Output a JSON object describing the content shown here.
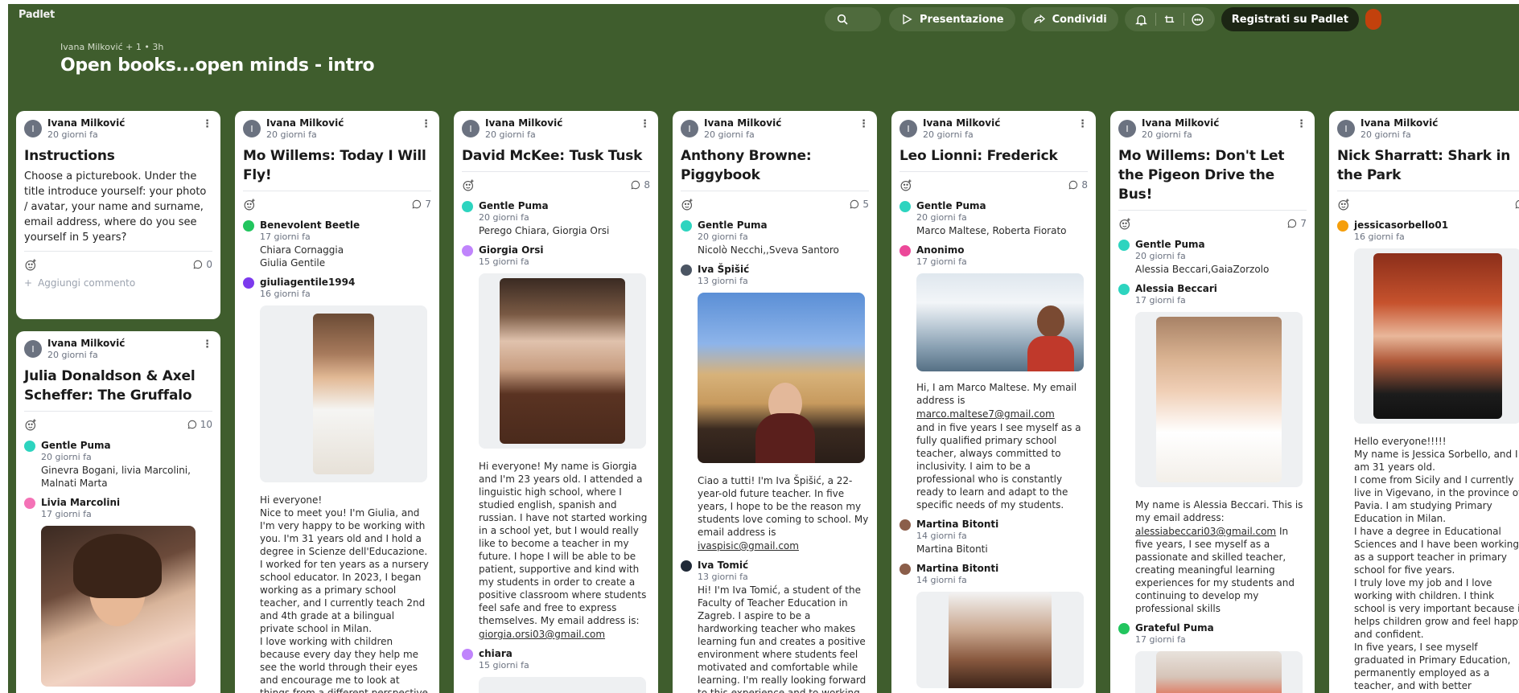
{
  "app": {
    "logo": "Padlet"
  },
  "topbar": {
    "presentation_label": "Presentazione",
    "share_label": "Condividi",
    "signup_label": "Registrati su Padlet"
  },
  "board": {
    "meta": "Ivana Milković + 1 • 3h",
    "title": "Open books...open minds - intro"
  },
  "cards": {
    "instructions": {
      "author": "Ivana Milković",
      "initial": "I",
      "time": "20 giorni fa",
      "title": "Instructions",
      "body": "Choose a picturebook. Under the title introduce yourself: your photo / avatar, your name and surname, email address, where do you see yourself in 5 years?",
      "comments_count": "0",
      "add_comment": "Aggiungi commento"
    },
    "gruffalo": {
      "author": "Ivana Milković",
      "initial": "I",
      "time": "20 giorni fa",
      "title": "Julia Donaldson & Axel Scheffer: The Gruffalo",
      "comments_count": "10",
      "c1": {
        "name": "Gentle Puma",
        "time": "20 giorni fa",
        "text": "Ginevra Bogani, livia Marcolini, Malnati Marta"
      },
      "c2": {
        "name": "Livia Marcolini",
        "time": "17 giorni fa"
      }
    },
    "willems": {
      "author": "Ivana Milković",
      "initial": "I",
      "time": "20 giorni fa",
      "title": "Mo Willems: Today I Will Fly!",
      "comments_count": "7",
      "c1": {
        "name": "Benevolent Beetle",
        "time": "17 giorni fa",
        "text": "Chiara Cornaggia\nGiulia Gentile"
      },
      "c2": {
        "name": "giuliagentile1994",
        "time": "16 giorni fa",
        "text": "Hi everyone!\nNice to meet you! I'm Giulia, and I'm very happy to be working with you. I'm 31 years old and I hold a degree in Scienze dell'Educazione. I worked for ten years as a nursery school educator. In 2023, I began working as a primary school teacher, and I currently teach 2nd and 4th grade at a bilingual private school in Milan.\nI love working with children because every day they help me see the world through their eyes and encourage me to look at things from a different perspective.\nMy email address is"
      }
    },
    "tusk": {
      "author": "Ivana Milković",
      "initial": "I",
      "time": "20 giorni fa",
      "title": "David McKee: Tusk Tusk",
      "comments_count": "8",
      "c1": {
        "name": "Gentle Puma",
        "time": "20 giorni fa",
        "text": "Perego Chiara, Giorgia Orsi"
      },
      "c2": {
        "name": "Giorgia Orsi",
        "time": "15 giorni fa",
        "text": "Hi everyone! My name is Giorgia and I'm 23 years old. I attended a linguistic high school, where I studied english, spanish and russian. I have not started working in a school yet, but I would really like to become a teacher in my future. I hope I will be able to be patient, supportive and kind with my students in order to create a positive classroom where students feel safe and free to express themselves. My email address is:",
        "email": "giorgia.orsi03@gmail.com"
      },
      "c3": {
        "name": "chiara",
        "time": "15 giorni fa"
      }
    },
    "piggybook": {
      "author": "Ivana Milković",
      "initial": "I",
      "time": "20 giorni fa",
      "title": "Anthony Browne: Piggybook",
      "comments_count": "5",
      "c1": {
        "name": "Gentle Puma",
        "time": "20 giorni fa",
        "text": "Nicolò Necchi,,Sveva Santoro"
      },
      "c2": {
        "name": "Iva Špišić",
        "time": "13 giorni fa",
        "text": "Ciao a tutti! I'm Iva Špišić, a 22-year-old future teacher. In five years, I hope to be the reason my students love coming to school. My email address is",
        "email": "ivaspisic@gmail.com"
      },
      "c3": {
        "name": "Iva Tomić",
        "time": "13 giorni fa",
        "text": "Hi! I'm Iva Tomić, a student of the Faculty of Teacher Education in Zagreb. I aspire to be a hardworking teacher who makes learning fun and creates a positive environment where students feel motivated and comfortable while learning. I'm really looking forward to this experience and to working"
      }
    },
    "frederick": {
      "author": "Ivana Milković",
      "initial": "I",
      "time": "20 giorni fa",
      "title": "Leo Lionni: Frederick",
      "comments_count": "8",
      "c1": {
        "name": "Gentle Puma",
        "time": "20 giorni fa",
        "text": "Marco Maltese, Roberta Fiorato"
      },
      "c2": {
        "name": "Anonimo",
        "time": "17 giorni fa",
        "text_a": "Hi, I am Marco Maltese. My email address is",
        "email": "marco.maltese7@gmail.com",
        "text_b": "and in five years I see myself as a fully qualified primary school teacher, always committed to inclusivity. I aim to be a professional who is constantly ready to learn and adapt to the specific needs of my students."
      },
      "c3": {
        "name": "Martina Bitonti",
        "time": "14 giorni fa",
        "text": "Martina Bitonti"
      },
      "c4": {
        "name": "Martina Bitonti",
        "time": "14 giorni fa"
      }
    },
    "pigeon": {
      "author": "Ivana Milković",
      "initial": "I",
      "time": "20 giorni fa",
      "title": "Mo Willems: Don't Let the Pigeon Drive the Bus!",
      "comments_count": "7",
      "c1": {
        "name": "Gentle Puma",
        "time": "20 giorni fa",
        "text": "Alessia Beccari,GaiaZorzolo"
      },
      "c2": {
        "name": "Alessia Beccari",
        "time": "17 giorni fa",
        "text_a": "My name is Alessia Beccari. This is my email address:",
        "email": "alessiabeccari03@gmail.com",
        "text_b": " In five years, I see myself as a passionate and skilled teacher, creating meaningful learning experiences for my students and continuing to develop my professional skills"
      },
      "c3": {
        "name": "Grateful Puma",
        "time": "17 giorni fa"
      }
    },
    "shark": {
      "author": "Ivana Milković",
      "initial": "I",
      "time": "20 giorni fa",
      "title": "Nick Sharratt: Shark in the Park",
      "c1": {
        "name": "jessicasorbello01",
        "time": "16 giorni fa",
        "text": "Hello everyone!!!!!\nMy name is Jessica Sorbello, and I am 31 years old.\nI come from Sicily and I currently live in Vigevano, in the province of Pavia. I am studying Primary Education in Milan.\nI have a degree in Educational Sciences and I have been working as a support teacher in primary school for five years.\nI truly love my job and I love working with children. I think school is very important because it helps children grow and feel happy and confident.\nIn five years, I see myself graduated in Primary Education, permanently employed as a teacher, and with better"
      }
    }
  },
  "colors": {
    "board_bg": "#3f5d2d",
    "pill_bg": "#4f6b3d",
    "signup_bg": "#1c2614"
  }
}
